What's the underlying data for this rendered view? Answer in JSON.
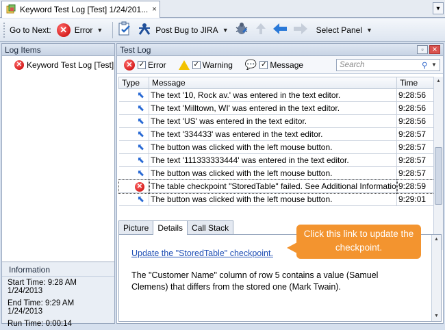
{
  "window": {
    "tab_title": "Keyword Test Log [Test]  1/24/201...",
    "close_glyph": "×",
    "dropdown_glyph": "▼"
  },
  "toolbar": {
    "goto_next_label": "Go to Next:",
    "error_label": "Error",
    "post_bug_label": "Post Bug to JIRA",
    "select_panel_label": "Select Panel"
  },
  "log_items": {
    "header": "Log Items",
    "tree_item": "Keyword Test Log [Test]"
  },
  "information": {
    "header": "Information",
    "start_time": "Start Time: 9:28 AM 1/24/2013",
    "end_time": "End Time: 9:29 AM 1/24/2013",
    "run_time": "Run Time: 0:00:14"
  },
  "test_log": {
    "header": "Test Log",
    "filters": {
      "error": "Error",
      "warning": "Warning",
      "message": "Message"
    },
    "search_placeholder": "Search",
    "columns": [
      "Type",
      "Message",
      "Time"
    ],
    "rows": [
      {
        "type": "cursor",
        "message": "The text '10, Rock av.' was entered in the text editor.",
        "time": "9:28:56"
      },
      {
        "type": "cursor",
        "message": "The text 'Milltown, WI' was entered in the text editor.",
        "time": "9:28:56"
      },
      {
        "type": "cursor",
        "message": "The text 'US' was entered in the text editor.",
        "time": "9:28:56"
      },
      {
        "type": "cursor",
        "message": "The text '334433' was entered in the text editor.",
        "time": "9:28:57"
      },
      {
        "type": "cursor",
        "message": "The button was clicked with the left mouse button.",
        "time": "9:28:57"
      },
      {
        "type": "cursor",
        "message": "The text '111333333444' was entered in the text editor.",
        "time": "9:28:57"
      },
      {
        "type": "cursor",
        "message": "The button was clicked with the left mouse button.",
        "time": "9:28:57"
      },
      {
        "type": "error",
        "message": "The table checkpoint \"StoredTable\" failed. See Additional Information fo...",
        "time": "9:28:59"
      },
      {
        "type": "cursor",
        "message": "The button was clicked with the left mouse button.",
        "time": "9:29:01"
      }
    ]
  },
  "details": {
    "tabs": [
      "Picture",
      "Details",
      "Call Stack"
    ],
    "active_tab": "Details",
    "link_text": "Update the \"StoredTable\" checkpoint.",
    "description": "The \"Customer Name\" column of row 5 contains a value (Samuel Clemens) that differs from the stored one (Mark Twain).",
    "callout": "Click this link to update the checkpoint."
  },
  "colors": {
    "accent": "#f3942f",
    "link": "#1f4fb5",
    "error": "#c40000"
  }
}
